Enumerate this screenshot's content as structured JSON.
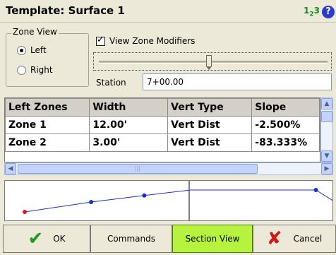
{
  "window": {
    "title": "Template: Surface 1"
  },
  "header_icons": {
    "units_main": "1",
    "units_sub": "2",
    "units_tail": "3",
    "help_glyph": "?"
  },
  "zone_view": {
    "label": "Zone View",
    "options": [
      {
        "label": "Left",
        "selected": true
      },
      {
        "label": "Right",
        "selected": false
      }
    ]
  },
  "view_zone_modifiers": {
    "label": "View Zone Modifiers",
    "checked": true
  },
  "slider": {
    "position_percent": 48
  },
  "station": {
    "label": "Station",
    "value": "7+00.00"
  },
  "table": {
    "headers": [
      "Left Zones",
      "Width",
      "Vert Type",
      "Slope"
    ],
    "rows": [
      [
        "Zone 1",
        "12.00'",
        "Vert Dist",
        "-2.500%"
      ],
      [
        "Zone 2",
        "3.00'",
        "Vert Dist",
        "-83.333%"
      ]
    ]
  },
  "profile": {
    "left_points": [
      [
        0,
        0
      ],
      [
        1,
        0.45
      ],
      [
        1.8,
        0.75
      ],
      [
        2.5,
        1.0
      ]
    ],
    "right_points": [
      [
        0,
        1.0
      ],
      [
        2.3,
        1.0
      ],
      [
        3.2,
        0.45
      ],
      [
        4.2,
        0.45
      ]
    ],
    "colors": {
      "line": "#1a2fd0",
      "start_point": "#e01818",
      "divider": "#000000"
    }
  },
  "buttons": {
    "ok": "OK",
    "commands": "Commands",
    "section_view": "Section View",
    "cancel": "Cancel"
  },
  "colors": {
    "section_view_bg": "#b6f23e",
    "ok_check": "#1f9a1f",
    "cancel_x": "#d01a1a"
  }
}
